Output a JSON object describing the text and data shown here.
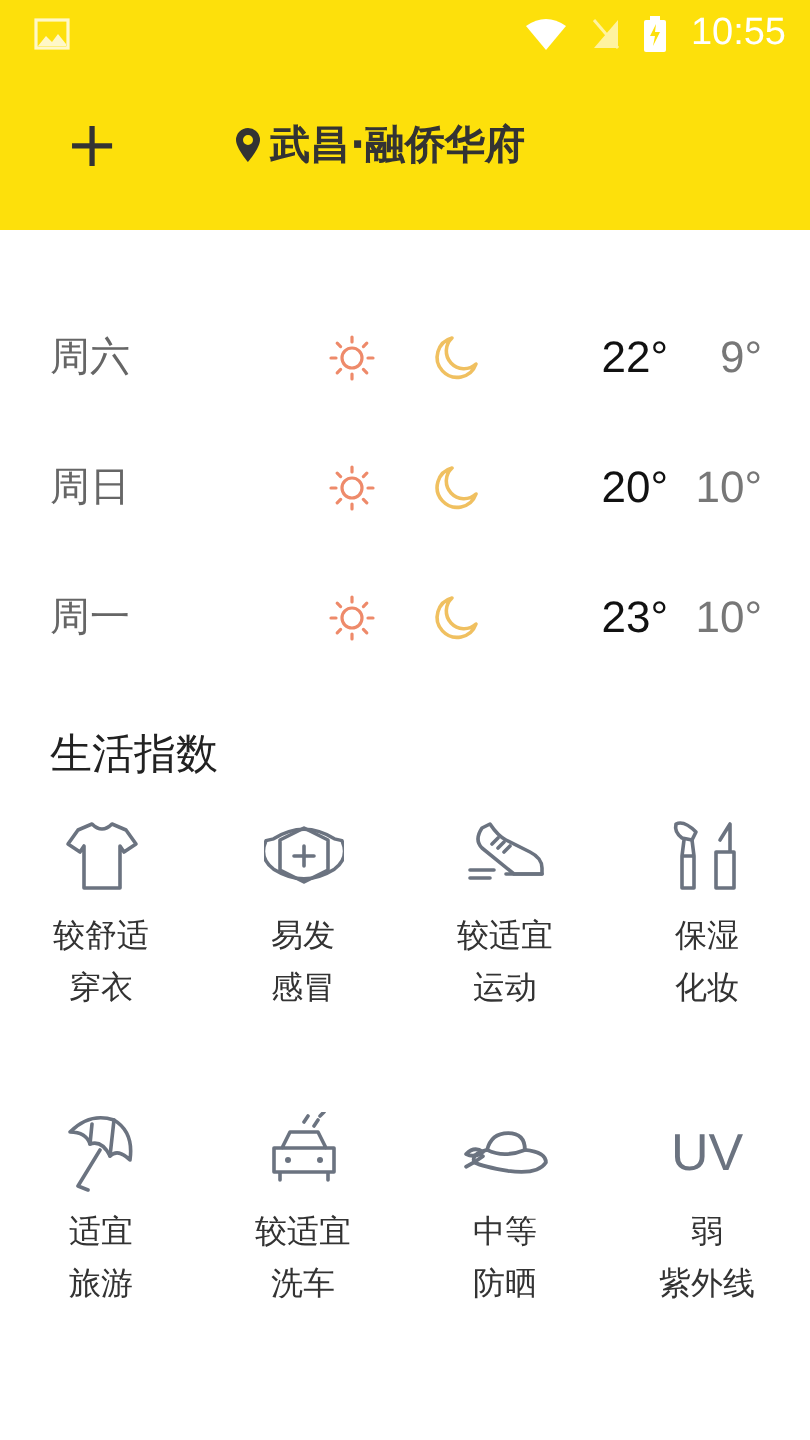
{
  "status_bar": {
    "time": "10:55"
  },
  "toolbar": {
    "add_label": "+",
    "location": "武昌·融侨华府"
  },
  "forecast": [
    {
      "day": "周六",
      "icons": [
        {
          "kind": "sunny"
        },
        {
          "kind": "moon"
        }
      ],
      "high": "22°",
      "low": "9°"
    },
    {
      "day": "周日",
      "icons": [
        {
          "kind": "sunny"
        },
        {
          "kind": "moon"
        }
      ],
      "high": "20°",
      "low": "10°"
    },
    {
      "day": "周一",
      "icons": [
        {
          "kind": "sunny"
        },
        {
          "kind": "moon"
        }
      ],
      "high": "23°",
      "low": "10°"
    }
  ],
  "life_index": {
    "title": "生活指数",
    "items": [
      {
        "kind": "shirt",
        "lines": [
          "较舒适",
          "穿衣"
        ]
      },
      {
        "kind": "mask",
        "lines": [
          "易发",
          "感冒"
        ]
      },
      {
        "kind": "shoe",
        "lines": [
          "较适宜",
          "运动"
        ]
      },
      {
        "kind": "makeup",
        "lines": [
          "保湿",
          "化妆"
        ]
      },
      {
        "kind": "umbrella",
        "lines": [
          "适宜",
          "旅游"
        ]
      },
      {
        "kind": "car",
        "lines": [
          "较适宜",
          "洗车"
        ]
      },
      {
        "kind": "hat",
        "lines": [
          "中等",
          "防晒"
        ]
      },
      {
        "kind": "text",
        "badge": "UV",
        "lines": [
          "弱",
          "紫外线"
        ]
      }
    ]
  }
}
